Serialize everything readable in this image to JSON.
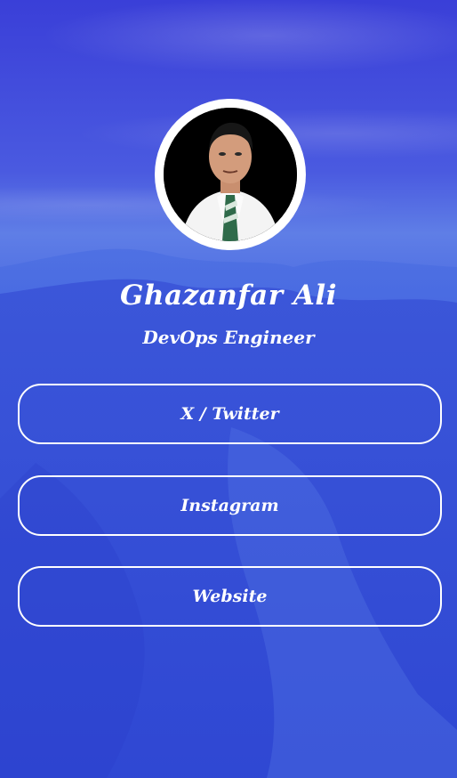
{
  "profile": {
    "name": "Ghazanfar Ali",
    "role": "DevOps Engineer"
  },
  "links": [
    {
      "label": "X / Twitter"
    },
    {
      "label": "Instagram"
    },
    {
      "label": "Website"
    }
  ],
  "colors": {
    "background_blue": "#3553de",
    "text": "#ffffff",
    "button_border": "#ffffff"
  }
}
